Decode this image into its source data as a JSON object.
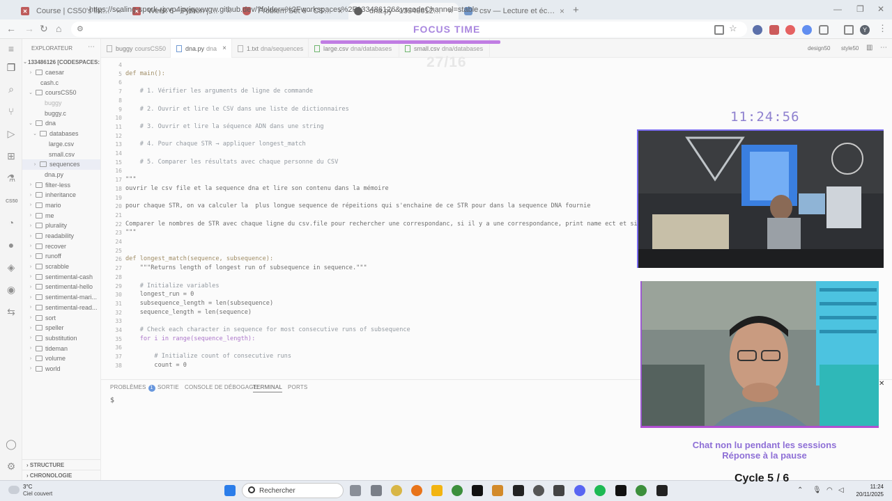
{
  "browser": {
    "tabs": [
      {
        "title": "Course | CS50's Introduction to",
        "icon": "cs50-favicon"
      },
      {
        "title": "Week 6 - Python | CS50x 2025",
        "icon": "cs50-favicon"
      },
      {
        "title": "Problem Set 6 - CS50x 2025",
        "icon": "shield-favicon"
      },
      {
        "title": "dna.py - 133486126 [Codespac",
        "icon": "github-favicon"
      },
      {
        "title": "csv — Lecture et écriture de fic",
        "icon": "python-favicon"
      }
    ],
    "url": "https://scaling-spork-rjxvp4jprjqcxwgw.github.dev/?folder=%2Fworkspaces%2F133486126&vscodeChannel=stable",
    "profile_initial": "Y"
  },
  "overlay": {
    "focus_title": "FOCUS TIME",
    "session_counter": "27/16",
    "clock": "11:24:56",
    "chat_line1": "Chat non lu pendant les sessions",
    "chat_line2": "Réponse à la pause",
    "cycle": "Cycle 5 / 6"
  },
  "vscode": {
    "explorer_title": "EXPLORATEUR",
    "workspace": "133486126 [CODESPACES: ...",
    "tree": [
      {
        "label": "caesar",
        "type": "folder",
        "depth": 1,
        "chev": "›"
      },
      {
        "label": "cash.c",
        "type": "file",
        "depth": 1
      },
      {
        "label": "coursCS50",
        "type": "folder",
        "depth": 1,
        "chev": "⌄"
      },
      {
        "label": "buggy",
        "type": "file",
        "depth": 2,
        "dim": true
      },
      {
        "label": "buggy.c",
        "type": "file",
        "depth": 2
      },
      {
        "label": "dna",
        "type": "folder",
        "depth": 1,
        "chev": "⌄"
      },
      {
        "label": "databases",
        "type": "folder",
        "depth": 2,
        "chev": "⌄"
      },
      {
        "label": "large.csv",
        "type": "file",
        "depth": 3
      },
      {
        "label": "small.csv",
        "type": "file",
        "depth": 3
      },
      {
        "label": "sequences",
        "type": "folder",
        "depth": 2,
        "chev": "›",
        "selected": true
      },
      {
        "label": "dna.py",
        "type": "file",
        "depth": 2
      },
      {
        "label": "filter-less",
        "type": "folder",
        "depth": 1,
        "chev": "›"
      },
      {
        "label": "inheritance",
        "type": "folder",
        "depth": 1,
        "chev": "›"
      },
      {
        "label": "mario",
        "type": "folder",
        "depth": 1,
        "chev": "›"
      },
      {
        "label": "me",
        "type": "folder",
        "depth": 1,
        "chev": "›"
      },
      {
        "label": "plurality",
        "type": "folder",
        "depth": 1,
        "chev": "›"
      },
      {
        "label": "readability",
        "type": "folder",
        "depth": 1,
        "chev": "›"
      },
      {
        "label": "recover",
        "type": "folder",
        "depth": 1,
        "chev": "›"
      },
      {
        "label": "runoff",
        "type": "folder",
        "depth": 1,
        "chev": "›"
      },
      {
        "label": "scrabble",
        "type": "folder",
        "depth": 1,
        "chev": "›"
      },
      {
        "label": "sentimental-cash",
        "type": "folder",
        "depth": 1,
        "chev": "›"
      },
      {
        "label": "sentimental-hello",
        "type": "folder",
        "depth": 1,
        "chev": "›"
      },
      {
        "label": "sentimental-mari...",
        "type": "folder",
        "depth": 1,
        "chev": "›"
      },
      {
        "label": "sentimental-read...",
        "type": "folder",
        "depth": 1,
        "chev": "›"
      },
      {
        "label": "sort",
        "type": "folder",
        "depth": 1,
        "chev": "›"
      },
      {
        "label": "speller",
        "type": "folder",
        "depth": 1,
        "chev": "›"
      },
      {
        "label": "substitution",
        "type": "folder",
        "depth": 1,
        "chev": "›"
      },
      {
        "label": "tideman",
        "type": "folder",
        "depth": 1,
        "chev": "›"
      },
      {
        "label": "volume",
        "type": "folder",
        "depth": 1,
        "chev": "›"
      },
      {
        "label": "world",
        "type": "folder",
        "depth": 1,
        "chev": "›"
      }
    ],
    "footer": [
      "STRUCTURE",
      "CHRONOLOGIE"
    ],
    "editor_tabs": [
      {
        "name": "buggy",
        "path": "coursCS50"
      },
      {
        "name": "dna.py",
        "path": "dna",
        "active": true
      },
      {
        "name": "1.txt",
        "path": "dna/sequences"
      },
      {
        "name": "large.csv",
        "path": "dna/databases"
      },
      {
        "name": "small.csv",
        "path": "dna/databases"
      }
    ],
    "editor_right": [
      "design50",
      "style50"
    ],
    "code": [
      {
        "n": "4",
        "t": ""
      },
      {
        "n": "5",
        "t": "def main():",
        "k": "def"
      },
      {
        "n": "6",
        "t": ""
      },
      {
        "n": "7",
        "t": "    # 1. Vérifier les arguments de ligne de commande",
        "k": "cm"
      },
      {
        "n": "8",
        "t": ""
      },
      {
        "n": "9",
        "t": "    # 2. Ouvrir et lire le CSV dans une liste de dictionnaires",
        "k": "cm"
      },
      {
        "n": "10",
        "t": ""
      },
      {
        "n": "11",
        "t": "    # 3. Ouvrir et lire la séquence ADN dans une string",
        "k": "cm"
      },
      {
        "n": "12",
        "t": ""
      },
      {
        "n": "13",
        "t": "    # 4. Pour chaque STR → appliquer longest_match",
        "k": "cm"
      },
      {
        "n": "14",
        "t": ""
      },
      {
        "n": "15",
        "t": "    # 5. Comparer les résultats avec chaque personne du CSV",
        "k": "cm"
      },
      {
        "n": "16",
        "t": ""
      },
      {
        "n": "17",
        "t": "\"\"\""
      },
      {
        "n": "18",
        "t": "ouvrir le csv file et la sequence dna et lire son contenu dans la mémoire"
      },
      {
        "n": "19",
        "t": ""
      },
      {
        "n": "20",
        "t": "pour chaque STR, on va calculer la  plus longue sequence de répeitions qui s'enchaine de ce STR pour dans la sequence DNA fournie"
      },
      {
        "n": "21",
        "t": ""
      },
      {
        "n": "22",
        "t": "Comparer le nombres de STR avec chaque ligne du csv.file pour rechercher une correspondanc, si il y a une correspondance, print name ect et sinon pri"
      },
      {
        "n": "23",
        "t": "\"\"\""
      },
      {
        "n": "24",
        "t": ""
      },
      {
        "n": "25",
        "t": ""
      },
      {
        "n": "26",
        "t": "def longest_match(sequence, subsequence):",
        "k": "def"
      },
      {
        "n": "27",
        "t": "    \"\"\"Returns length of longest run of subsequence in sequence.\"\"\""
      },
      {
        "n": "28",
        "t": ""
      },
      {
        "n": "29",
        "t": "    # Initialize variables",
        "k": "cm"
      },
      {
        "n": "30",
        "t": "    longest_run = 0"
      },
      {
        "n": "31",
        "t": "    subsequence_length = len(subsequence)"
      },
      {
        "n": "32",
        "t": "    sequence_length = len(sequence)"
      },
      {
        "n": "33",
        "t": ""
      },
      {
        "n": "34",
        "t": "    # Check each character in sequence for most consecutive runs of subsequence",
        "k": "cm"
      },
      {
        "n": "35",
        "t": "    for i in range(sequence_length):",
        "k": "for"
      },
      {
        "n": "36",
        "t": ""
      },
      {
        "n": "37",
        "t": "        # Initialize count of consecutive runs",
        "k": "cm"
      },
      {
        "n": "38",
        "t": "        count = 0"
      }
    ],
    "panel_tabs": [
      {
        "label": "PROBLÈMES",
        "badge": "1"
      },
      {
        "label": "SORTIE"
      },
      {
        "label": "CONSOLE DE DÉBOGAGE"
      },
      {
        "label": "TERMINAL",
        "active": true
      },
      {
        "label": "PORTS"
      }
    ],
    "terminal_prompt": "$"
  },
  "taskbar": {
    "weather_temp": "3°C",
    "weather_desc": "Ciel couvert",
    "search_label": "Rechercher",
    "time": "11:24",
    "date": "20/11/2025"
  },
  "colors": {
    "accent_purple": "#a987df",
    "focus_bar": "#c07de3",
    "clock": "#8e80cf"
  }
}
